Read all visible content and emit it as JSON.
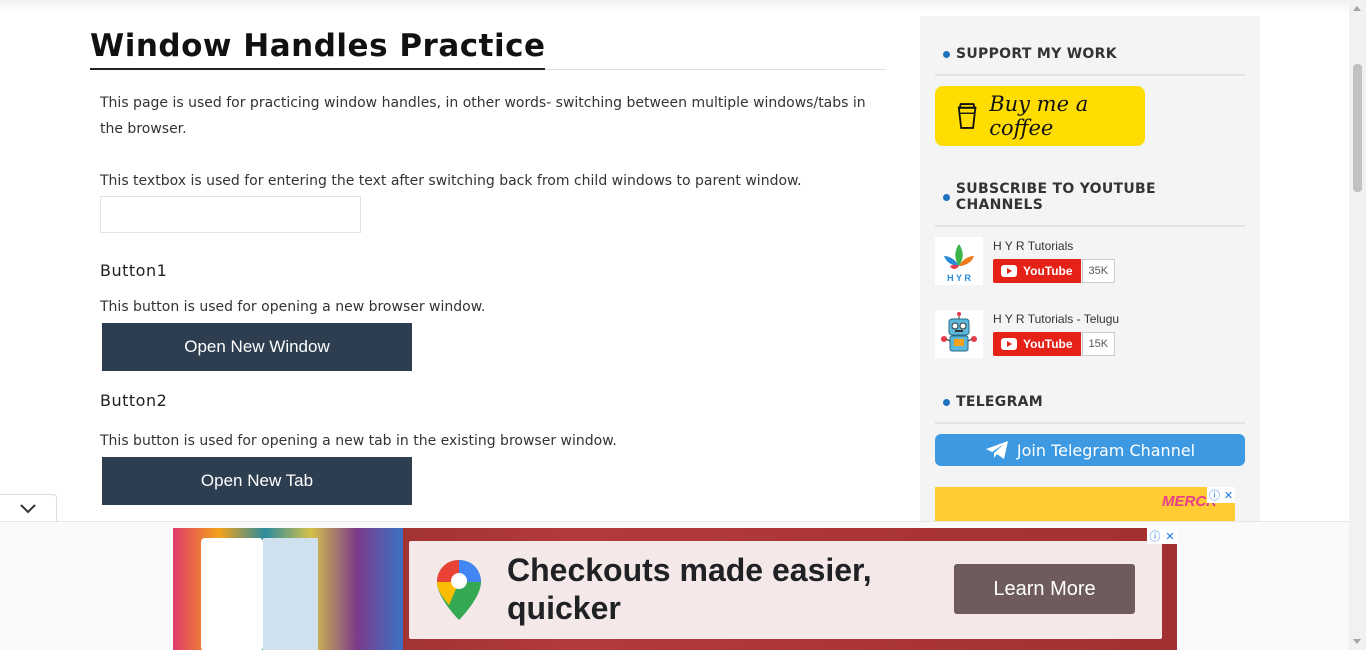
{
  "main": {
    "title": "Window Handles Practice",
    "intro": "This page is used for practicing window handles, in other words- switching between multiple windows/tabs in the browser.",
    "textbox_desc": "This textbox is used for entering the text after switching back from child windows to parent window.",
    "textbox_value": "",
    "button1": {
      "heading": "Button1",
      "description": "This button is used for opening a new browser window.",
      "label": "Open New Window"
    },
    "button2": {
      "heading": "Button2",
      "description": "This button is used for opening a new tab in the existing browser window.",
      "label": "Open New Tab"
    }
  },
  "sidebar": {
    "support_heading": "SUPPORT MY WORK",
    "coffee_label": "Buy me a coffee",
    "subscribe_heading": "SUBSCRIBE TO YOUTUBE CHANNELS",
    "channels": [
      {
        "name": "H Y R Tutorials",
        "button": "YouTube",
        "count": "35K",
        "logo_text": "H Y R"
      },
      {
        "name": "H Y R Tutorials - Telugu",
        "button": "YouTube",
        "count": "15K"
      }
    ],
    "telegram_heading": "TELEGRAM",
    "telegram_label": "Join Telegram Channel",
    "ad_brand": "MERCK"
  },
  "bottom_ad": {
    "headline": "Checkouts made easier, quicker",
    "cta": "Learn More"
  },
  "colors": {
    "accent": "#1e73be",
    "dark_button": "#2d3e50",
    "coffee": "#ffdd00",
    "telegram": "#3d9ae2",
    "youtube": "#e62117"
  }
}
